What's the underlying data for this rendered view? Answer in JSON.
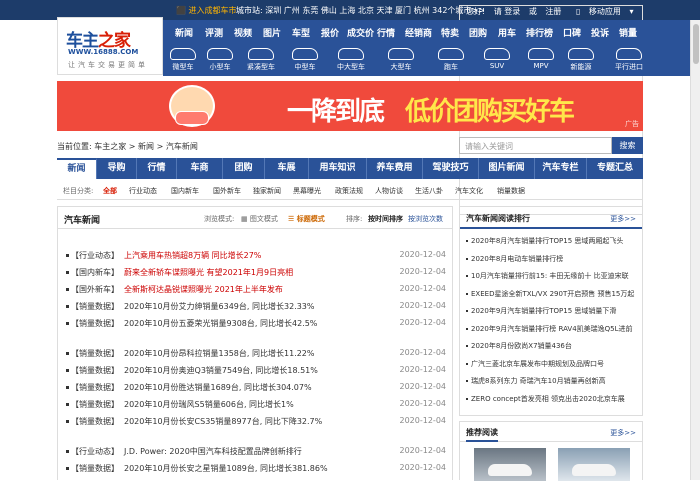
{
  "topbar": {
    "enter": "进入成都车市",
    "cities_label": "城市站:",
    "cities": "深圳 广州 东莞 佛山 上海 北京 天津 厦门 杭州",
    "cities_more": "342个城市>>",
    "greeting": "您好!",
    "login": "请 登录",
    "or": "或",
    "register": "注册",
    "mobile": "移动应用"
  },
  "logo": {
    "name_blue": "车主",
    "name_red": "之家",
    "url": "WWW.16888.COM",
    "slogan": "让汽车交易更简单"
  },
  "mainnav": [
    "新闻",
    "评测",
    "视频",
    "图片",
    "车型",
    "报价",
    "成交价",
    "行情",
    "经销商",
    "特卖",
    "团购",
    "用车",
    "排行榜",
    "口碑",
    "投诉",
    "销量"
  ],
  "subnav": [
    "微型车",
    "小型车",
    "紧凑型车",
    "中型车",
    "中大型车",
    "大型车",
    "跑车",
    "SUV",
    "MPV",
    "新能源",
    "平行进口"
  ],
  "banner": {
    "slogan1": "一降到底",
    "slogan2": "低价团购买好车",
    "ad": "广告"
  },
  "breadcrumb": {
    "label": "当前位置:",
    "home": "车主之家",
    "sep1": ">",
    "news": "新闻",
    "sep2": ">",
    "current": "汽车新闻"
  },
  "search": {
    "placeholder": "请输入关键词",
    "button": "搜索"
  },
  "cattabs": [
    "新闻",
    "导购",
    "行情",
    "车商",
    "团购",
    "车展",
    "用车知识",
    "养车费用",
    "驾驶技巧",
    "图片新闻",
    "汽车专栏",
    "专题汇总"
  ],
  "columns": {
    "label": "栏目分类:",
    "items": [
      "全部",
      "行业动态",
      "国内新车",
      "国外新车",
      "独家新闻",
      "黑幕曝光",
      "政策法规",
      "人物访谈",
      "生活八卦",
      "汽车文化",
      "销量数据"
    ]
  },
  "left": {
    "title": "汽车新闻",
    "mode_label": "浏览模式:",
    "mode1": "图文模式",
    "mode2": "标题模式",
    "sort_label": "排序:",
    "sort1": "按时间排序",
    "sort2": "按浏览次数",
    "news": [
      {
        "tag": "【行业动态】",
        "text": "上汽乘用车热销超8万辆 同比增长27%",
        "red": true,
        "date": "2020-12-04"
      },
      {
        "tag": "【国内新车】",
        "text": "蔚来全新轿车谍照曝光 有望2021年1月9日亮相",
        "red": true,
        "date": "2020-12-04"
      },
      {
        "tag": "【国外新车】",
        "text": "全新斯柯达晶锐谍照曝光 2021年上半年发布",
        "red": true,
        "date": "2020-12-04"
      },
      {
        "tag": "【销量数据】",
        "text": "2020年10月份艾力绅销量6349台, 同比增长32.33%",
        "red": false,
        "date": "2020-12-04"
      },
      {
        "tag": "【销量数据】",
        "text": "2020年10月份五菱荣光销量9308台, 同比增长42.5%",
        "red": false,
        "date": "2020-12-04"
      },
      {
        "tag": "【销量数据】",
        "text": "2020年10月份昂科拉销量1358台, 同比增长11.22%",
        "red": false,
        "date": "2020-12-04"
      },
      {
        "tag": "【销量数据】",
        "text": "2020年10月份奥迪Q3销量7549台, 同比增长18.51%",
        "red": false,
        "date": "2020-12-04"
      },
      {
        "tag": "【销量数据】",
        "text": "2020年10月份胜达销量1689台, 同比增长304.07%",
        "red": false,
        "date": "2020-12-04"
      },
      {
        "tag": "【销量数据】",
        "text": "2020年10月份瑞风S5销量606台, 同比增长1%",
        "red": false,
        "date": "2020-12-04"
      },
      {
        "tag": "【销量数据】",
        "text": "2020年10月份长安CS35销量8977台, 同比下降32.7%",
        "red": false,
        "date": "2020-12-04"
      },
      {
        "tag": "【行业动态】",
        "text": "J.D. Power: 2020中国汽车科技配置品牌创新排行",
        "red": false,
        "date": "2020-12-04"
      },
      {
        "tag": "【销量数据】",
        "text": "2020年10月份长安之星销量1089台, 同比增长381.86%",
        "red": false,
        "date": "2020-12-04"
      }
    ]
  },
  "rank": {
    "title": "汽车新闻阅读排行",
    "more": "更多>>",
    "items": [
      "2020年8月汽车销量排行TOP15 思域两厢起飞头",
      "2020年8月电动车销量排行榜",
      "10月汽车销量排行前15: 丰田无缘前十 比亚迪宋联",
      "EXEED星途全新TXL/VX 290T开启预售 预售15万起",
      "2020年9月汽车销量排行TOP15 思域销量下滑",
      "2020年9月汽车销量排行榜 RAV4凯美瑞逸Q5L进前",
      "2020年8月份欧尚X7销量436台",
      "广汽三菱北京车展发布中期规划及品牌口号",
      "瑞虎8系列东力 奇瑞汽车10月销量再创新高",
      "ZERO concept首发亮相 领克出击2020北京车展"
    ]
  },
  "recommend": {
    "title": "推荐阅读",
    "more": "更多>>"
  }
}
